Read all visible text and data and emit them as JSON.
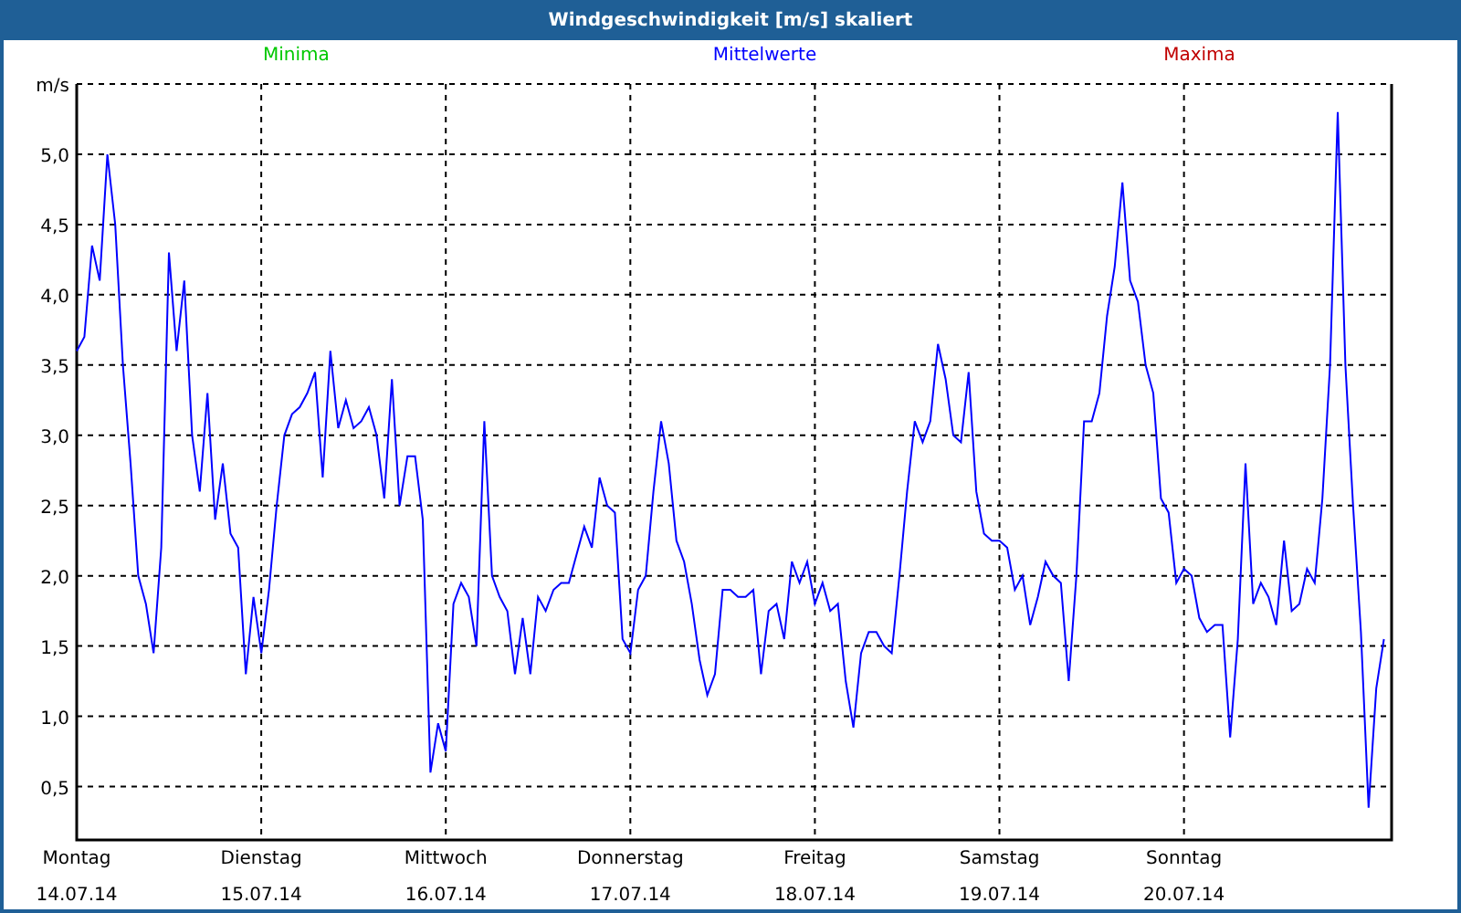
{
  "window": {
    "title": "Windgeschwindigkeit [m/s] skaliert"
  },
  "legend": [
    {
      "label": "Minima",
      "color": "#00c800"
    },
    {
      "label": "Maxima",
      "color": "#c00000"
    }
  ],
  "chart_data": {
    "type": "line",
    "grid": true,
    "ylabel": "m/s",
    "ylim": [
      0.12,
      5.5
    ],
    "yticks": [
      {
        "value": 0.5,
        "label": "0,5"
      },
      {
        "value": 1,
        "label": "1,0"
      },
      {
        "value": 1.5,
        "label": "1,5"
      },
      {
        "value": 2,
        "label": "2,0"
      },
      {
        "value": 2.5,
        "label": "2,5"
      },
      {
        "value": 3,
        "label": "3,0"
      },
      {
        "value": 3.5,
        "label": "3,5"
      },
      {
        "value": 4,
        "label": "4,0"
      },
      {
        "value": 4.5,
        "label": "4,5"
      },
      {
        "value": 5,
        "label": "5,0"
      }
    ],
    "categories": [
      "Montag",
      null,
      null,
      null,
      null,
      null,
      null,
      null,
      null,
      null,
      null,
      null,
      null,
      null,
      null,
      null,
      null,
      null,
      null,
      null,
      null,
      null,
      null,
      null,
      "Dienstag",
      null,
      null,
      null,
      null,
      null,
      null,
      null,
      null,
      null,
      null,
      null,
      null,
      null,
      null,
      null,
      null,
      null,
      null,
      null,
      null,
      null,
      null,
      null,
      "Mittwoch",
      null,
      null,
      null,
      null,
      null,
      null,
      null,
      null,
      null,
      null,
      null,
      null,
      null,
      null,
      null,
      null,
      null,
      null,
      null,
      null,
      null,
      null,
      null,
      "Donnerstag",
      null,
      null,
      null,
      null,
      null,
      null,
      null,
      null,
      null,
      null,
      null,
      null,
      null,
      null,
      null,
      null,
      null,
      null,
      null,
      null,
      null,
      null,
      null,
      "Freitag",
      null,
      null,
      null,
      null,
      null,
      null,
      null,
      null,
      null,
      null,
      null,
      null,
      null,
      null,
      null,
      null,
      null,
      null,
      null,
      null,
      null,
      null,
      null,
      "Samstag",
      null,
      null,
      null,
      null,
      null,
      null,
      null,
      null,
      null,
      null,
      null,
      null,
      null,
      null,
      null,
      null,
      null,
      null,
      null,
      null,
      null,
      null,
      null,
      "Sonntag",
      null,
      null,
      null,
      null,
      null,
      null,
      null,
      null,
      null,
      null,
      null,
      null,
      null,
      null,
      null,
      null,
      null,
      null,
      null,
      null,
      null,
      null,
      null,
      null,
      null,
      null
    ],
    "series": [
      {
        "name": "Mittelwerte",
        "color": "#0000ff",
        "values": [
          3.6,
          3.7,
          4.35,
          4.1,
          5.0,
          4.5,
          3.5,
          2.8,
          2.0,
          1.8,
          1.45,
          2.2,
          4.3,
          3.6,
          4.1,
          3.0,
          2.6,
          3.3,
          2.4,
          2.8,
          2.3,
          2.2,
          1.3,
          1.85,
          1.45,
          1.9,
          2.5,
          3.0,
          3.15,
          3.2,
          3.3,
          3.45,
          2.7,
          3.6,
          3.05,
          3.25,
          3.05,
          3.1,
          3.2,
          3.0,
          2.55,
          3.4,
          2.5,
          2.85,
          2.85,
          2.4,
          0.6,
          0.95,
          0.75,
          1.8,
          1.95,
          1.85,
          1.5,
          3.1,
          2.0,
          1.85,
          1.75,
          1.3,
          1.7,
          1.3,
          1.85,
          1.75,
          1.9,
          1.95,
          1.95,
          2.15,
          2.35,
          2.2,
          2.7,
          2.5,
          2.45,
          1.55,
          1.45,
          1.9,
          2.0,
          2.6,
          3.1,
          2.8,
          2.25,
          2.1,
          1.8,
          1.4,
          1.15,
          1.3,
          1.9,
          1.9,
          1.85,
          1.85,
          1.9,
          1.3,
          1.75,
          1.8,
          1.55,
          2.1,
          1.95,
          2.1,
          1.8,
          1.95,
          1.75,
          1.8,
          1.25,
          0.92,
          1.45,
          1.6,
          1.6,
          1.5,
          1.45,
          2.0,
          2.6,
          3.1,
          2.95,
          3.1,
          3.65,
          3.4,
          3.0,
          2.95,
          3.45,
          2.6,
          2.3,
          2.25,
          2.25,
          2.2,
          1.9,
          2.0,
          1.65,
          1.85,
          2.1,
          2.0,
          1.95,
          1.25,
          2.0,
          3.1,
          3.1,
          3.3,
          3.85,
          4.2,
          4.8,
          4.1,
          3.95,
          3.5,
          3.3,
          2.55,
          2.45,
          1.95,
          2.05,
          2.0,
          1.7,
          1.6,
          1.65,
          1.65,
          0.85,
          1.55,
          2.8,
          1.8,
          1.95,
          1.85,
          1.65,
          2.25,
          1.75,
          1.8,
          2.05,
          1.95,
          2.55,
          3.5,
          5.3,
          3.5,
          2.5,
          1.6,
          0.35,
          1.2,
          1.55
        ]
      }
    ]
  },
  "xtick_dates": [
    "14.07.14",
    "15.07.14",
    "16.07.14",
    "17.07.14",
    "18.07.14",
    "19.07.14",
    "20.07.14"
  ]
}
